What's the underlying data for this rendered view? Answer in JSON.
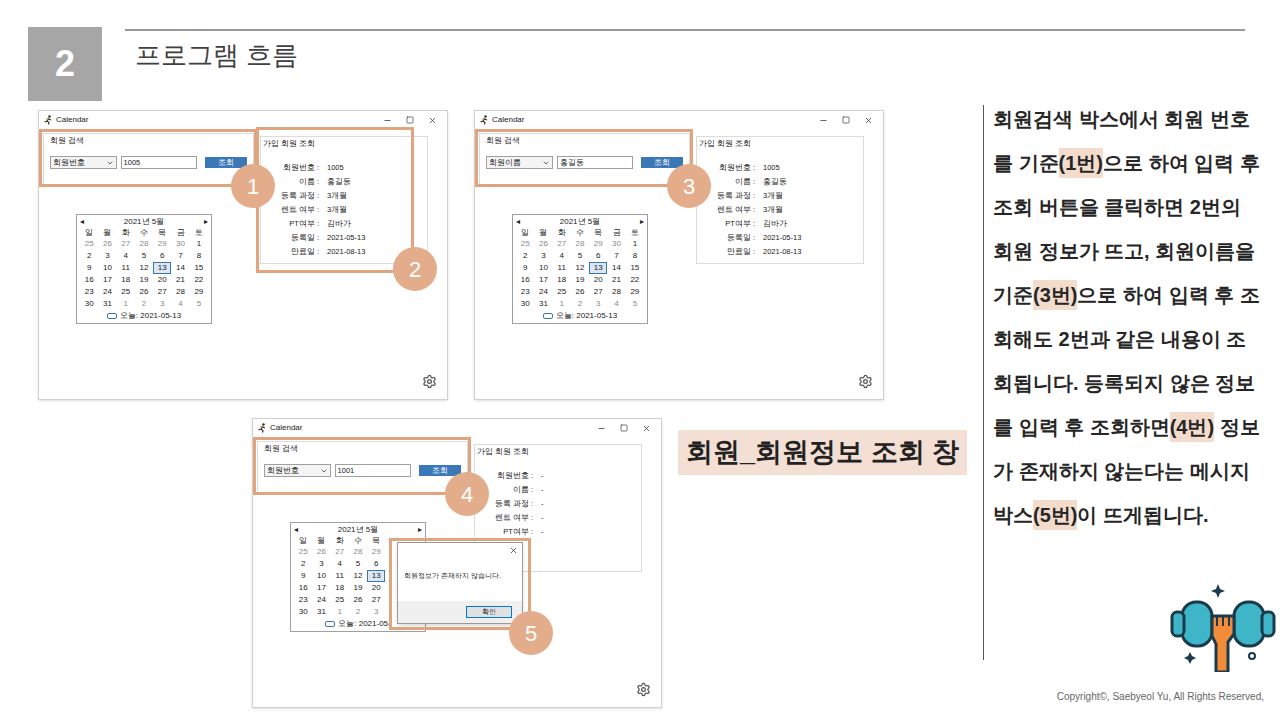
{
  "slide": {
    "section_number": "2",
    "title": "프로그램 흐름",
    "caption": "회원_회원정보 조회 창",
    "copyright": "Copyright©, Saebyeol Yu, All Rights Reserved,"
  },
  "description": [
    {
      "text": "회원검색 박스에서 회원 번호를 기준",
      "highlighted": false
    },
    {
      "text": "(1번)",
      "highlighted": true
    },
    {
      "text": "으로 하여 입력 후 조회 버튼을 클릭하면 2번의 회원 정보가 뜨고, 회원이름을 기준",
      "highlighted": false
    },
    {
      "text": "(3번)",
      "highlighted": true
    },
    {
      "text": "으로 하여 입력 후 조회해도 2번과 같은 내용이 조회됩니다. 등록되지 않은 정보를 입력 후 조회하면",
      "highlighted": false
    },
    {
      "text": "(4번)",
      "highlighted": true
    },
    {
      "text": " 정보가 존재하지 않는다는 메시지 박스",
      "highlighted": false
    },
    {
      "text": "(5번)",
      "highlighted": true
    },
    {
      "text": "이 뜨게됩니다.",
      "highlighted": false
    }
  ],
  "windows": [
    {
      "title": "Calendar",
      "search": {
        "label": "회원 검색",
        "field": "회원번호",
        "value": "1005",
        "button": "조회"
      },
      "info": {
        "label": "가입 회원 조회",
        "fields": [
          {
            "label": "회원번호 :",
            "value": "1005"
          },
          {
            "label": "이름 :",
            "value": "홍길동"
          },
          {
            "label": "등록 과정 :",
            "value": "3개월"
          },
          {
            "label": "렌트 여부 :",
            "value": "3개월"
          },
          {
            "label": "PT여부 :",
            "value": "김바가"
          },
          {
            "label": "등록일 :",
            "value": "2021-05-13"
          },
          {
            "label": "만료일 :",
            "value": "2021-08-13"
          }
        ]
      },
      "calendar": {
        "prev": "◂",
        "month": "2021년 5월",
        "next": "▸",
        "weekdays": [
          "일",
          "월",
          "화",
          "수",
          "목",
          "금",
          "토"
        ],
        "weeks": [
          [
            {
              "day": "25",
              "other": true,
              "selected": false
            },
            {
              "day": "26",
              "other": true,
              "selected": false
            },
            {
              "day": "27",
              "other": true,
              "selected": false
            },
            {
              "day": "28",
              "other": true,
              "selected": false
            },
            {
              "day": "29",
              "other": true,
              "selected": false
            },
            {
              "day": "30",
              "other": true,
              "selected": false
            },
            {
              "day": "1",
              "other": false,
              "selected": false
            }
          ],
          [
            {
              "day": "2",
              "other": false,
              "selected": false
            },
            {
              "day": "3",
              "other": false,
              "selected": false
            },
            {
              "day": "4",
              "other": false,
              "selected": false
            },
            {
              "day": "5",
              "other": false,
              "selected": false
            },
            {
              "day": "6",
              "other": false,
              "selected": false
            },
            {
              "day": "7",
              "other": false,
              "selected": false
            },
            {
              "day": "8",
              "other": false,
              "selected": false
            }
          ],
          [
            {
              "day": "9",
              "other": false,
              "selected": false
            },
            {
              "day": "10",
              "other": false,
              "selected": false
            },
            {
              "day": "11",
              "other": false,
              "selected": false
            },
            {
              "day": "12",
              "other": false,
              "selected": false
            },
            {
              "day": "13",
              "other": false,
              "selected": true
            },
            {
              "day": "14",
              "other": false,
              "selected": false
            },
            {
              "day": "15",
              "other": false,
              "selected": false
            }
          ],
          [
            {
              "day": "16",
              "other": false,
              "selected": false
            },
            {
              "day": "17",
              "other": false,
              "selected": false
            },
            {
              "day": "18",
              "other": false,
              "selected": false
            },
            {
              "day": "19",
              "other": false,
              "selected": false
            },
            {
              "day": "20",
              "other": false,
              "selected": false
            },
            {
              "day": "21",
              "other": false,
              "selected": false
            },
            {
              "day": "22",
              "other": false,
              "selected": false
            }
          ],
          [
            {
              "day": "23",
              "other": false,
              "selected": false
            },
            {
              "day": "24",
              "other": false,
              "selected": false
            },
            {
              "day": "25",
              "other": false,
              "selected": false
            },
            {
              "day": "26",
              "other": false,
              "selected": false
            },
            {
              "day": "27",
              "other": false,
              "selected": false
            },
            {
              "day": "28",
              "other": false,
              "selected": false
            },
            {
              "day": "29",
              "other": false,
              "selected": false
            }
          ],
          [
            {
              "day": "30",
              "other": false,
              "selected": false
            },
            {
              "day": "31",
              "other": false,
              "selected": false
            },
            {
              "day": "1",
              "other": true,
              "selected": false
            },
            {
              "day": "2",
              "other": true,
              "selected": false
            },
            {
              "day": "3",
              "other": true,
              "selected": false
            },
            {
              "day": "4",
              "other": true,
              "selected": false
            },
            {
              "day": "5",
              "other": true,
              "selected": false
            }
          ]
        ],
        "today": "오늘: 2021-05-13"
      },
      "dialog": null,
      "callouts": [
        {
          "number": "1",
          "target": "search"
        },
        {
          "number": "2",
          "target": "info"
        }
      ]
    },
    {
      "title": "Calendar",
      "search": {
        "label": "회원 검색",
        "field": "회원이름",
        "value": "홍길동",
        "button": "조회"
      },
      "info": {
        "label": "가입 회원 조회",
        "fields": [
          {
            "label": "회원번호 :",
            "value": "1005"
          },
          {
            "label": "이름 :",
            "value": "홍길동"
          },
          {
            "label": "등록 과정 :",
            "value": "3개월"
          },
          {
            "label": "렌트 여부 :",
            "value": "3개월"
          },
          {
            "label": "PT여부 :",
            "value": "김바가"
          },
          {
            "label": "등록일 :",
            "value": "2021-05-13"
          },
          {
            "label": "만료일 :",
            "value": "2021-08-13"
          }
        ]
      },
      "calendar": {
        "prev": "◂",
        "month": "2021년 5월",
        "next": "▸",
        "weekdays": [
          "일",
          "월",
          "화",
          "수",
          "목",
          "금",
          "토"
        ],
        "weeks": [
          [
            {
              "day": "25",
              "other": true,
              "selected": false
            },
            {
              "day": "26",
              "other": true,
              "selected": false
            },
            {
              "day": "27",
              "other": true,
              "selected": false
            },
            {
              "day": "28",
              "other": true,
              "selected": false
            },
            {
              "day": "29",
              "other": true,
              "selected": false
            },
            {
              "day": "30",
              "other": true,
              "selected": false
            },
            {
              "day": "1",
              "other": false,
              "selected": false
            }
          ],
          [
            {
              "day": "2",
              "other": false,
              "selected": false
            },
            {
              "day": "3",
              "other": false,
              "selected": false
            },
            {
              "day": "4",
              "other": false,
              "selected": false
            },
            {
              "day": "5",
              "other": false,
              "selected": false
            },
            {
              "day": "6",
              "other": false,
              "selected": false
            },
            {
              "day": "7",
              "other": false,
              "selected": false
            },
            {
              "day": "8",
              "other": false,
              "selected": false
            }
          ],
          [
            {
              "day": "9",
              "other": false,
              "selected": false
            },
            {
              "day": "10",
              "other": false,
              "selected": false
            },
            {
              "day": "11",
              "other": false,
              "selected": false
            },
            {
              "day": "12",
              "other": false,
              "selected": false
            },
            {
              "day": "13",
              "other": false,
              "selected": true
            },
            {
              "day": "14",
              "other": false,
              "selected": false
            },
            {
              "day": "15",
              "other": false,
              "selected": false
            }
          ],
          [
            {
              "day": "16",
              "other": false,
              "selected": false
            },
            {
              "day": "17",
              "other": false,
              "selected": false
            },
            {
              "day": "18",
              "other": false,
              "selected": false
            },
            {
              "day": "19",
              "other": false,
              "selected": false
            },
            {
              "day": "20",
              "other": false,
              "selected": false
            },
            {
              "day": "21",
              "other": false,
              "selected": false
            },
            {
              "day": "22",
              "other": false,
              "selected": false
            }
          ],
          [
            {
              "day": "23",
              "other": false,
              "selected": false
            },
            {
              "day": "24",
              "other": false,
              "selected": false
            },
            {
              "day": "25",
              "other": false,
              "selected": false
            },
            {
              "day": "26",
              "other": false,
              "selected": false
            },
            {
              "day": "27",
              "other": false,
              "selected": false
            },
            {
              "day": "28",
              "other": false,
              "selected": false
            },
            {
              "day": "29",
              "other": false,
              "selected": false
            }
          ],
          [
            {
              "day": "30",
              "other": false,
              "selected": false
            },
            {
              "day": "31",
              "other": false,
              "selected": false
            },
            {
              "day": "1",
              "other": true,
              "selected": false
            },
            {
              "day": "2",
              "other": true,
              "selected": false
            },
            {
              "day": "3",
              "other": true,
              "selected": false
            },
            {
              "day": "4",
              "other": true,
              "selected": false
            },
            {
              "day": "5",
              "other": true,
              "selected": false
            }
          ]
        ],
        "today": "오늘: 2021-05-13"
      },
      "dialog": null,
      "callouts": [
        {
          "number": "3",
          "target": "search"
        }
      ]
    },
    {
      "title": "Calendar",
      "search": {
        "label": "회원 검색",
        "field": "회원번호",
        "value": "1001",
        "button": "조회"
      },
      "info": {
        "label": "가입 회원 조회",
        "fields": [
          {
            "label": "회원번호 :",
            "value": "-"
          },
          {
            "label": "이름 :",
            "value": "-"
          },
          {
            "label": "등록 과정 :",
            "value": "-"
          },
          {
            "label": "렌트 여부 :",
            "value": "-"
          },
          {
            "label": "PT여부 :",
            "value": "-"
          }
        ]
      },
      "calendar": {
        "prev": "◂",
        "month": "2021년 5월",
        "next": "▸",
        "weekdays": [
          "일",
          "월",
          "화",
          "수",
          "목"
        ],
        "weeks": [
          [
            {
              "day": "25",
              "other": true,
              "selected": false
            },
            {
              "day": "26",
              "other": true,
              "selected": false
            },
            {
              "day": "27",
              "other": true,
              "selected": false
            },
            {
              "day": "28",
              "other": true,
              "selected": false
            },
            {
              "day": "29",
              "other": true,
              "selected": false
            }
          ],
          [
            {
              "day": "2",
              "other": false,
              "selected": false
            },
            {
              "day": "3",
              "other": false,
              "selected": false
            },
            {
              "day": "4",
              "other": false,
              "selected": false
            },
            {
              "day": "5",
              "other": false,
              "selected": false
            },
            {
              "day": "6",
              "other": false,
              "selected": false
            }
          ],
          [
            {
              "day": "9",
              "other": false,
              "selected": false
            },
            {
              "day": "10",
              "other": false,
              "selected": false
            },
            {
              "day": "11",
              "other": false,
              "selected": false
            },
            {
              "day": "12",
              "other": false,
              "selected": false
            },
            {
              "day": "13",
              "other": false,
              "selected": true
            }
          ],
          [
            {
              "day": "16",
              "other": false,
              "selected": false
            },
            {
              "day": "17",
              "other": false,
              "selected": false
            },
            {
              "day": "18",
              "other": false,
              "selected": false
            },
            {
              "day": "19",
              "other": false,
              "selected": false
            },
            {
              "day": "20",
              "other": false,
              "selected": false
            }
          ],
          [
            {
              "day": "23",
              "other": false,
              "selected": false
            },
            {
              "day": "24",
              "other": false,
              "selected": false
            },
            {
              "day": "25",
              "other": false,
              "selected": false
            },
            {
              "day": "26",
              "other": false,
              "selected": false
            },
            {
              "day": "27",
              "other": false,
              "selected": false
            }
          ],
          [
            {
              "day": "30",
              "other": false,
              "selected": false
            },
            {
              "day": "31",
              "other": false,
              "selected": false
            },
            {
              "day": "1",
              "other": true,
              "selected": false
            },
            {
              "day": "2",
              "other": true,
              "selected": false
            },
            {
              "day": "3",
              "other": true,
              "selected": false
            }
          ]
        ],
        "today": "오늘: 2021-05-"
      },
      "dialog": {
        "message": "회원정보가 존재하지 않습니다.",
        "button": "확인"
      },
      "callouts": [
        {
          "number": "4",
          "target": "search"
        },
        {
          "number": "5",
          "target": "dialog"
        }
      ]
    }
  ]
}
